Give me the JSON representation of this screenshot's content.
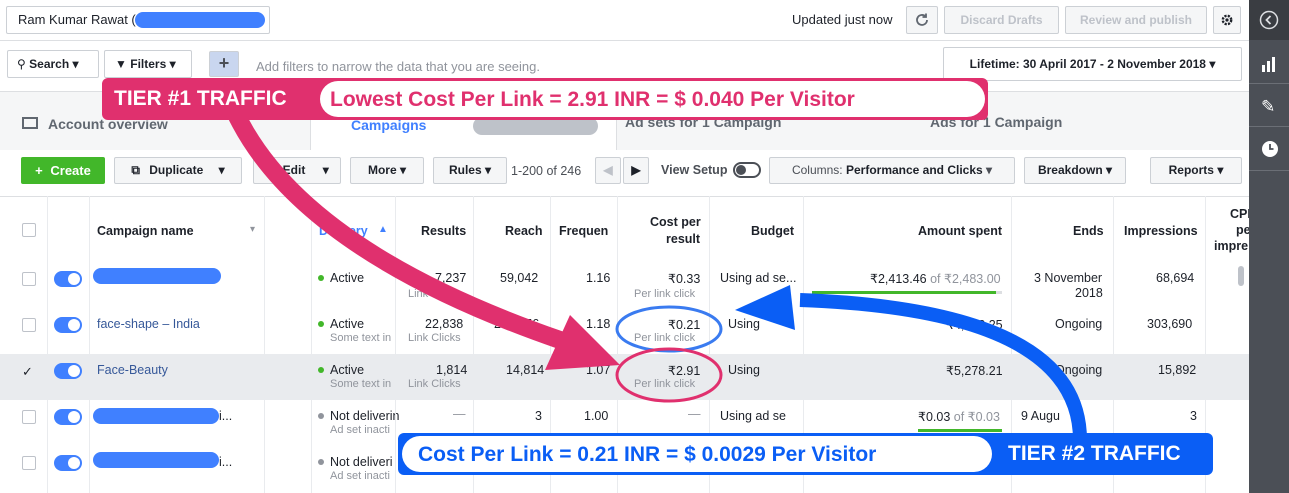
{
  "header": {
    "account_name": "Ram Kumar Rawat (",
    "updated_text": "Updated just now",
    "discard_label": "Discard Drafts",
    "review_label": "Review and publish"
  },
  "filters": {
    "search_label": "Search",
    "filters_label": "Filters",
    "placeholder": "Add filters to narrow the data that you are seeing.",
    "date_range": "Lifetime: 30 April 2017 - 2 November 2018"
  },
  "tabs": {
    "account_overview": "Account overview",
    "campaigns": "Campaigns",
    "ad_sets": "Ad sets for 1 Campaign",
    "ads": "Ads for 1 Campaign"
  },
  "toolbar": {
    "create": "Create",
    "duplicate": "Duplicate",
    "edit": "Edit",
    "more": "More",
    "rules": "Rules",
    "pagination": "1-200 of 246",
    "view_setup": "View Setup",
    "columns_prefix": "Columns:",
    "columns_value": "Performance and Clicks",
    "breakdown": "Breakdown",
    "reports": "Reports"
  },
  "table": {
    "headers": {
      "campaign_name": "Campaign name",
      "delivery": "Delivery",
      "results": "Results",
      "reach": "Reach",
      "frequency": "Frequen",
      "cost_per_result_1": "Cost per",
      "cost_per_result_2": "result",
      "budget": "Budget",
      "amount_spent": "Amount spent",
      "ends": "Ends",
      "impressions": "Impressions",
      "cpm_1": "CPM",
      "cpm_2": "per",
      "cpm_3": "impre"
    },
    "rows": [
      {
        "name": "",
        "delivery": "Active",
        "delivery_sub": "",
        "results": "7,237",
        "results_sub": "Link Clicks",
        "reach": "59,042",
        "frequency": "1.16",
        "cost": "₹0.33",
        "cost_sub": "Per link click",
        "budget": "Using ad se...",
        "spent": "₹2,413.46",
        "spent_of": "of ₹2,483.00",
        "ends": "3 November",
        "ends2": "2018",
        "impressions": "68,694"
      },
      {
        "name": "face-shape – India",
        "delivery": "Active",
        "delivery_sub": "Some text in",
        "results": "22,838",
        "results_sub": "Link Clicks",
        "reach": "257,856",
        "frequency": "1.18",
        "cost": "₹0.21",
        "cost_sub": "Per link click",
        "budget": "Using",
        "spent": "₹4,683.25",
        "spent_of": "",
        "ends": "Ongoing",
        "ends2": "",
        "impressions": "303,690"
      },
      {
        "name": "Face-Beauty",
        "delivery": "Active",
        "delivery_sub": "Some text in",
        "results": "1,814",
        "results_sub": "Link Clicks",
        "reach": "14,814",
        "frequency": "1.07",
        "cost": "₹2.91",
        "cost_sub": "Per link click",
        "budget": "Using",
        "spent": "₹5,278.21",
        "spent_of": "",
        "ends": "Ongoing",
        "ends2": "",
        "impressions": "15,892"
      },
      {
        "name": "i...",
        "delivery": "Not deliverin",
        "delivery_sub": "Ad set inacti",
        "results": "—",
        "results_sub": "",
        "reach": "3",
        "frequency": "1.00",
        "cost": "—",
        "cost_sub": "",
        "budget": "Using ad se",
        "spent": "₹0.03",
        "spent_of": "of ₹0.03",
        "ends": "9 Augu",
        "ends2": "",
        "impressions": "3"
      },
      {
        "name": "i...",
        "delivery": "Not deliveri",
        "delivery_sub": "Ad set inacti",
        "results": "",
        "results_sub": "",
        "reach": "",
        "frequency": "",
        "cost": "",
        "cost_sub": "",
        "budget": "",
        "spent": "",
        "spent_of": "",
        "ends": "",
        "ends2": "",
        "impressions": ""
      }
    ]
  },
  "annotations": {
    "tier1_label": "TIER #1 TRAFFIC",
    "tier1_text": "Lowest Cost Per Link = 2.91 INR = $ 0.040 Per Visitor",
    "tier2_label": "TIER #2 TRAFFIC",
    "tier2_text": "Cost Per Link = 0.21 INR = $ 0.0029 Per Visitor"
  },
  "colors": {
    "pink": "#e0306e",
    "blue": "#0a5ef5",
    "green": "#42b72a",
    "toggle": "#4080ff"
  }
}
